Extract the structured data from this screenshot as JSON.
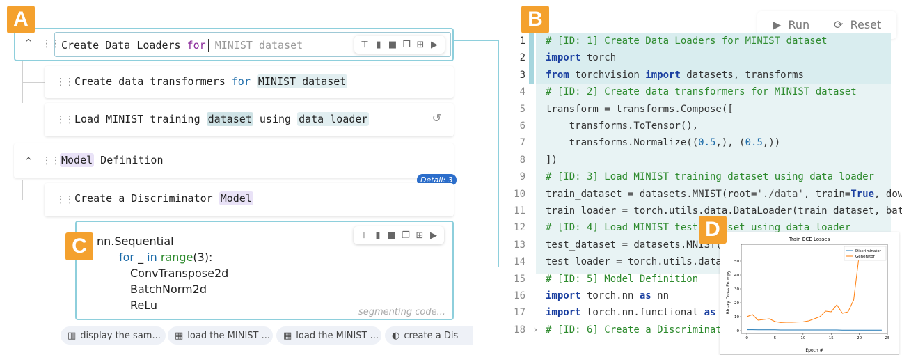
{
  "badges": {
    "a": "A",
    "b": "B",
    "c": "C",
    "d": "D"
  },
  "blocks": {
    "b1": {
      "parts": [
        "Create Data Loaders ",
        "for",
        " MINIST dataset"
      ]
    },
    "b2": {
      "parts": [
        "Create data transformers ",
        "for",
        " ",
        "MINIST dataset"
      ]
    },
    "b3": {
      "parts": [
        "Load MINIST training ",
        "dataset",
        " using ",
        "data loader"
      ]
    },
    "b4": {
      "parts": [
        "Model",
        " Definition"
      ]
    },
    "b5": {
      "parts": [
        "Create a Discriminator ",
        "Model"
      ]
    },
    "detail_badge": "Detail: 3",
    "seq": {
      "l1": "nn.Sequential",
      "l2a": "for",
      "l2b": " _ ",
      "l2c": "in",
      "l2d": " range",
      "l2e": "(3):",
      "l3": "ConvTranspose2d",
      "l4": "BatchNorm2d",
      "l5": "ReLu",
      "status": "segmenting code..."
    }
  },
  "chips": [
    {
      "icon": "bar-chart-icon",
      "label": "display the sam..."
    },
    {
      "icon": "table-icon",
      "label": "load the MINIST ..."
    },
    {
      "icon": "table-icon",
      "label": "load the MINIST ..."
    },
    {
      "icon": "model-icon",
      "label": "create a Dis"
    }
  ],
  "controls": {
    "run": "Run",
    "reset": "Reset"
  },
  "code": [
    {
      "n": "1",
      "t": "# [ID: 1] Create Data Loaders for MINIST dataset"
    },
    {
      "n": "2",
      "t": "import torch"
    },
    {
      "n": "3",
      "t": "from torchvision import datasets, transforms"
    },
    {
      "n": "4",
      "t": "# [ID: 2] Create data transformers for MINIST dataset"
    },
    {
      "n": "5",
      "t": "transform = transforms.Compose(["
    },
    {
      "n": "6",
      "t": "    transforms.ToTensor(),"
    },
    {
      "n": "7",
      "t": "    transforms.Normalize((0.5,), (0.5,))"
    },
    {
      "n": "8",
      "t": "])"
    },
    {
      "n": "9",
      "t": "# [ID: 3] Load MINIST training dataset using data loader"
    },
    {
      "n": "10",
      "t": "train_dataset = datasets.MNIST(root='./data', train=True, down"
    },
    {
      "n": "11",
      "t": "train_loader = torch.utils.data.DataLoader(train_dataset, batc"
    },
    {
      "n": "12",
      "t": "# [ID: 4] Load MINIST test dataset using data loader"
    },
    {
      "n": "13",
      "t": "test_dataset = datasets.MNIST(r"
    },
    {
      "n": "14",
      "t": "test_loader = torch.utils.data."
    },
    {
      "n": "15",
      "t": "# [ID: 5] Model Definition"
    },
    {
      "n": "16",
      "t": "import torch.nn as nn"
    },
    {
      "n": "17",
      "t": "import torch.nn.functional as F"
    },
    {
      "n": "18",
      "t": "# [ID: 6] Create a Discriminato"
    }
  ],
  "chart_data": {
    "type": "line",
    "title": "Train BCE Losses",
    "xlabel": "Epoch #",
    "ylabel": "Binary Cross Entropy",
    "xlim": [
      -1,
      25
    ],
    "ylim": [
      -2,
      62
    ],
    "xticks": [
      0,
      5,
      10,
      15,
      20,
      25
    ],
    "yticks": [
      0,
      10,
      20,
      30,
      40,
      50
    ],
    "legend_position": "top-right",
    "series": [
      {
        "name": "Discriminator",
        "color": "#1f77b4",
        "x": [
          0,
          1,
          2,
          3,
          4,
          5,
          6,
          7,
          8,
          9,
          10,
          11,
          12,
          13,
          14,
          15,
          16,
          17,
          18,
          19,
          20,
          21,
          22,
          23,
          24
        ],
        "values": [
          0.7,
          0.7,
          0.6,
          0.6,
          0.6,
          0.6,
          0.5,
          0.5,
          0.5,
          0.5,
          0.5,
          0.5,
          0.5,
          0.5,
          0.5,
          0.5,
          0.5,
          0.4,
          0.4,
          0.4,
          0.4,
          0.4,
          0.4,
          0.4,
          0.4
        ]
      },
      {
        "name": "Generator",
        "color": "#ff7f0e",
        "x": [
          0,
          1,
          2,
          3,
          4,
          5,
          6,
          7,
          8,
          9,
          10,
          11,
          12,
          13,
          14,
          15,
          16,
          17,
          18,
          19,
          20
        ],
        "values": [
          10,
          11.5,
          7.5,
          8,
          8.5,
          6.5,
          5.8,
          6,
          6,
          6.2,
          6.3,
          7,
          8.5,
          10,
          14,
          13.5,
          18.5,
          12.5,
          13.5,
          22,
          55
        ]
      }
    ]
  }
}
